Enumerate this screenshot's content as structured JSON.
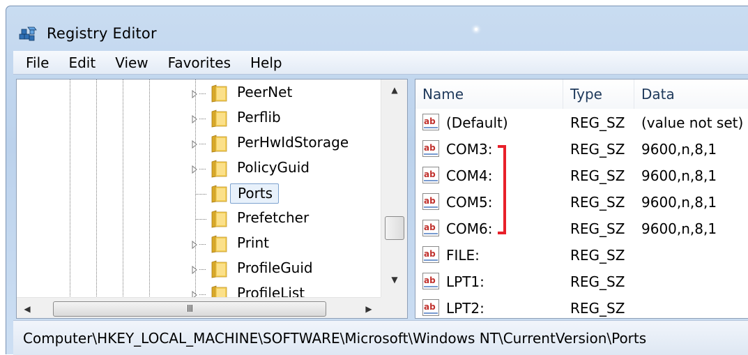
{
  "window": {
    "title": "Registry Editor"
  },
  "menu": [
    "File",
    "Edit",
    "View",
    "Favorites",
    "Help"
  ],
  "tree": {
    "items": [
      {
        "label": "PeerNet",
        "expandable": true,
        "selected": false
      },
      {
        "label": "Perflib",
        "expandable": true,
        "selected": false
      },
      {
        "label": "PerHwIdStorage",
        "expandable": true,
        "selected": false
      },
      {
        "label": "PolicyGuid",
        "expandable": true,
        "selected": false
      },
      {
        "label": "Ports",
        "expandable": false,
        "selected": true
      },
      {
        "label": "Prefetcher",
        "expandable": false,
        "selected": false
      },
      {
        "label": "Print",
        "expandable": true,
        "selected": false
      },
      {
        "label": "ProfileGuid",
        "expandable": true,
        "selected": false
      },
      {
        "label": "ProfileList",
        "expandable": true,
        "selected": false
      }
    ],
    "hscroll_grip": "III"
  },
  "list": {
    "columns": [
      "Name",
      "Type",
      "Data"
    ],
    "rows": [
      {
        "name": "(Default)",
        "type": "REG_SZ",
        "data": "(value not set)"
      },
      {
        "name": "COM3:",
        "type": "REG_SZ",
        "data": "9600,n,8,1"
      },
      {
        "name": "COM4:",
        "type": "REG_SZ",
        "data": "9600,n,8,1"
      },
      {
        "name": "COM5:",
        "type": "REG_SZ",
        "data": "9600,n,8,1"
      },
      {
        "name": "COM6:",
        "type": "REG_SZ",
        "data": "9600,n,8,1"
      },
      {
        "name": "FILE:",
        "type": "REG_SZ",
        "data": ""
      },
      {
        "name": "LPT1:",
        "type": "REG_SZ",
        "data": ""
      },
      {
        "name": "LPT2:",
        "type": "REG_SZ",
        "data": ""
      }
    ],
    "icon_text": "ab"
  },
  "annotation": {
    "color": "#e8202a",
    "highlighted_rows": [
      "COM3:",
      "COM4:",
      "COM5:",
      "COM6:"
    ]
  },
  "status": {
    "path": "Computer\\HKEY_LOCAL_MACHINE\\SOFTWARE\\Microsoft\\Windows NT\\CurrentVersion\\Ports"
  }
}
